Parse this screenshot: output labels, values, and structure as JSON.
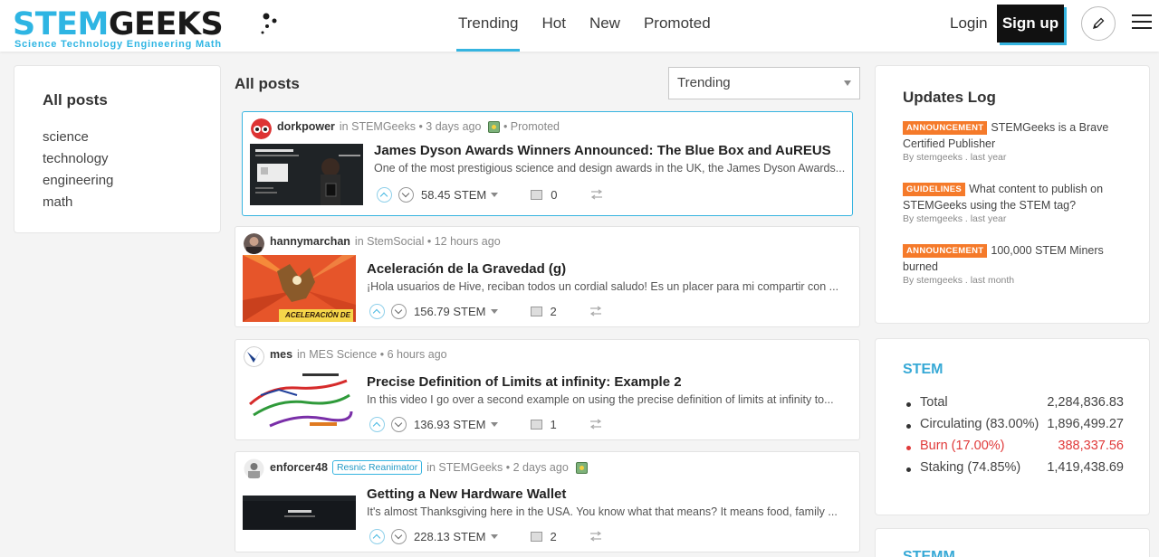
{
  "header": {
    "logo_stem": "STEM",
    "logo_geeks": "GEEKS",
    "logo_tagline": "Science Technology Engineering Math",
    "nav": [
      "Trending",
      "Hot",
      "New",
      "Promoted"
    ],
    "active_nav": "Trending",
    "login_label": "Login",
    "signup_label": "Sign up",
    "accent_color": "#35b4e0"
  },
  "sidebar_left": {
    "title": "All posts",
    "links": [
      "science",
      "technology",
      "engineering",
      "math"
    ]
  },
  "feed": {
    "title": "All posts",
    "sort_value": "Trending",
    "posts": [
      {
        "author": "dorkpower",
        "community": "in STEMGeeks",
        "time": "3 days ago",
        "promoted": "Promoted",
        "title": "James Dyson Awards Winners Announced: The Blue Box and AuREUS",
        "excerpt": "One of the most prestigious science and design awards in the UK, the James Dyson Awards...",
        "payout": "58.45 STEM",
        "comments": "0"
      },
      {
        "author": "hannymarchan",
        "community": "in StemSocial",
        "time": "12 hours ago",
        "title": "Aceleración de la Gravedad (g)",
        "excerpt": "¡Hola usuarios de Hive, reciban todos un cordial saludo! Es un placer para mi compartir con ...",
        "payout": "156.79 STEM",
        "comments": "2",
        "thumb_text": "ACELERACIÓN DE"
      },
      {
        "author": "mes",
        "community": "in MES Science",
        "time": "6 hours ago",
        "title": "Precise Definition of Limits at infinity: Example 2",
        "excerpt": "In this video I go over a second example on using the precise definition of limits at infinity to...",
        "payout": "136.93 STEM",
        "comments": "1"
      },
      {
        "author": "enforcer48",
        "badge": "Resnic Reanimator",
        "community": "in STEMGeeks",
        "time": "2 days ago",
        "title": "Getting a New Hardware Wallet",
        "excerpt": "It's almost Thanksgiving here in the USA. You know what that means? It means food, family ...",
        "payout": "228.13 STEM",
        "comments": "2"
      }
    ]
  },
  "sidebar_right": {
    "updates_title": "Updates Log",
    "updates": [
      {
        "tag": "ANNOUNCEMENT",
        "text": "STEMGeeks is a Brave Certified Publisher",
        "by": "By stemgeeks . last year"
      },
      {
        "tag": "GUIDELINES",
        "text": "What content to publish on STEMGeeks using the STEM tag?",
        "by": "By stemgeeks . last year"
      },
      {
        "tag": "ANNOUNCEMENT",
        "text": "100,000 STEM Miners burned",
        "by": "By stemgeeks . last month"
      }
    ],
    "token_title": "STEM",
    "token_stats": [
      {
        "label": "Total",
        "value": "2,284,836.83"
      },
      {
        "label": "Circulating (83.00%)",
        "value": "1,896,499.27"
      },
      {
        "label": "Burn (17.00%)",
        "value": "388,337.56"
      },
      {
        "label": "Staking (74.85%)",
        "value": "1,419,438.69"
      }
    ],
    "next_card_title": "STEMM"
  }
}
